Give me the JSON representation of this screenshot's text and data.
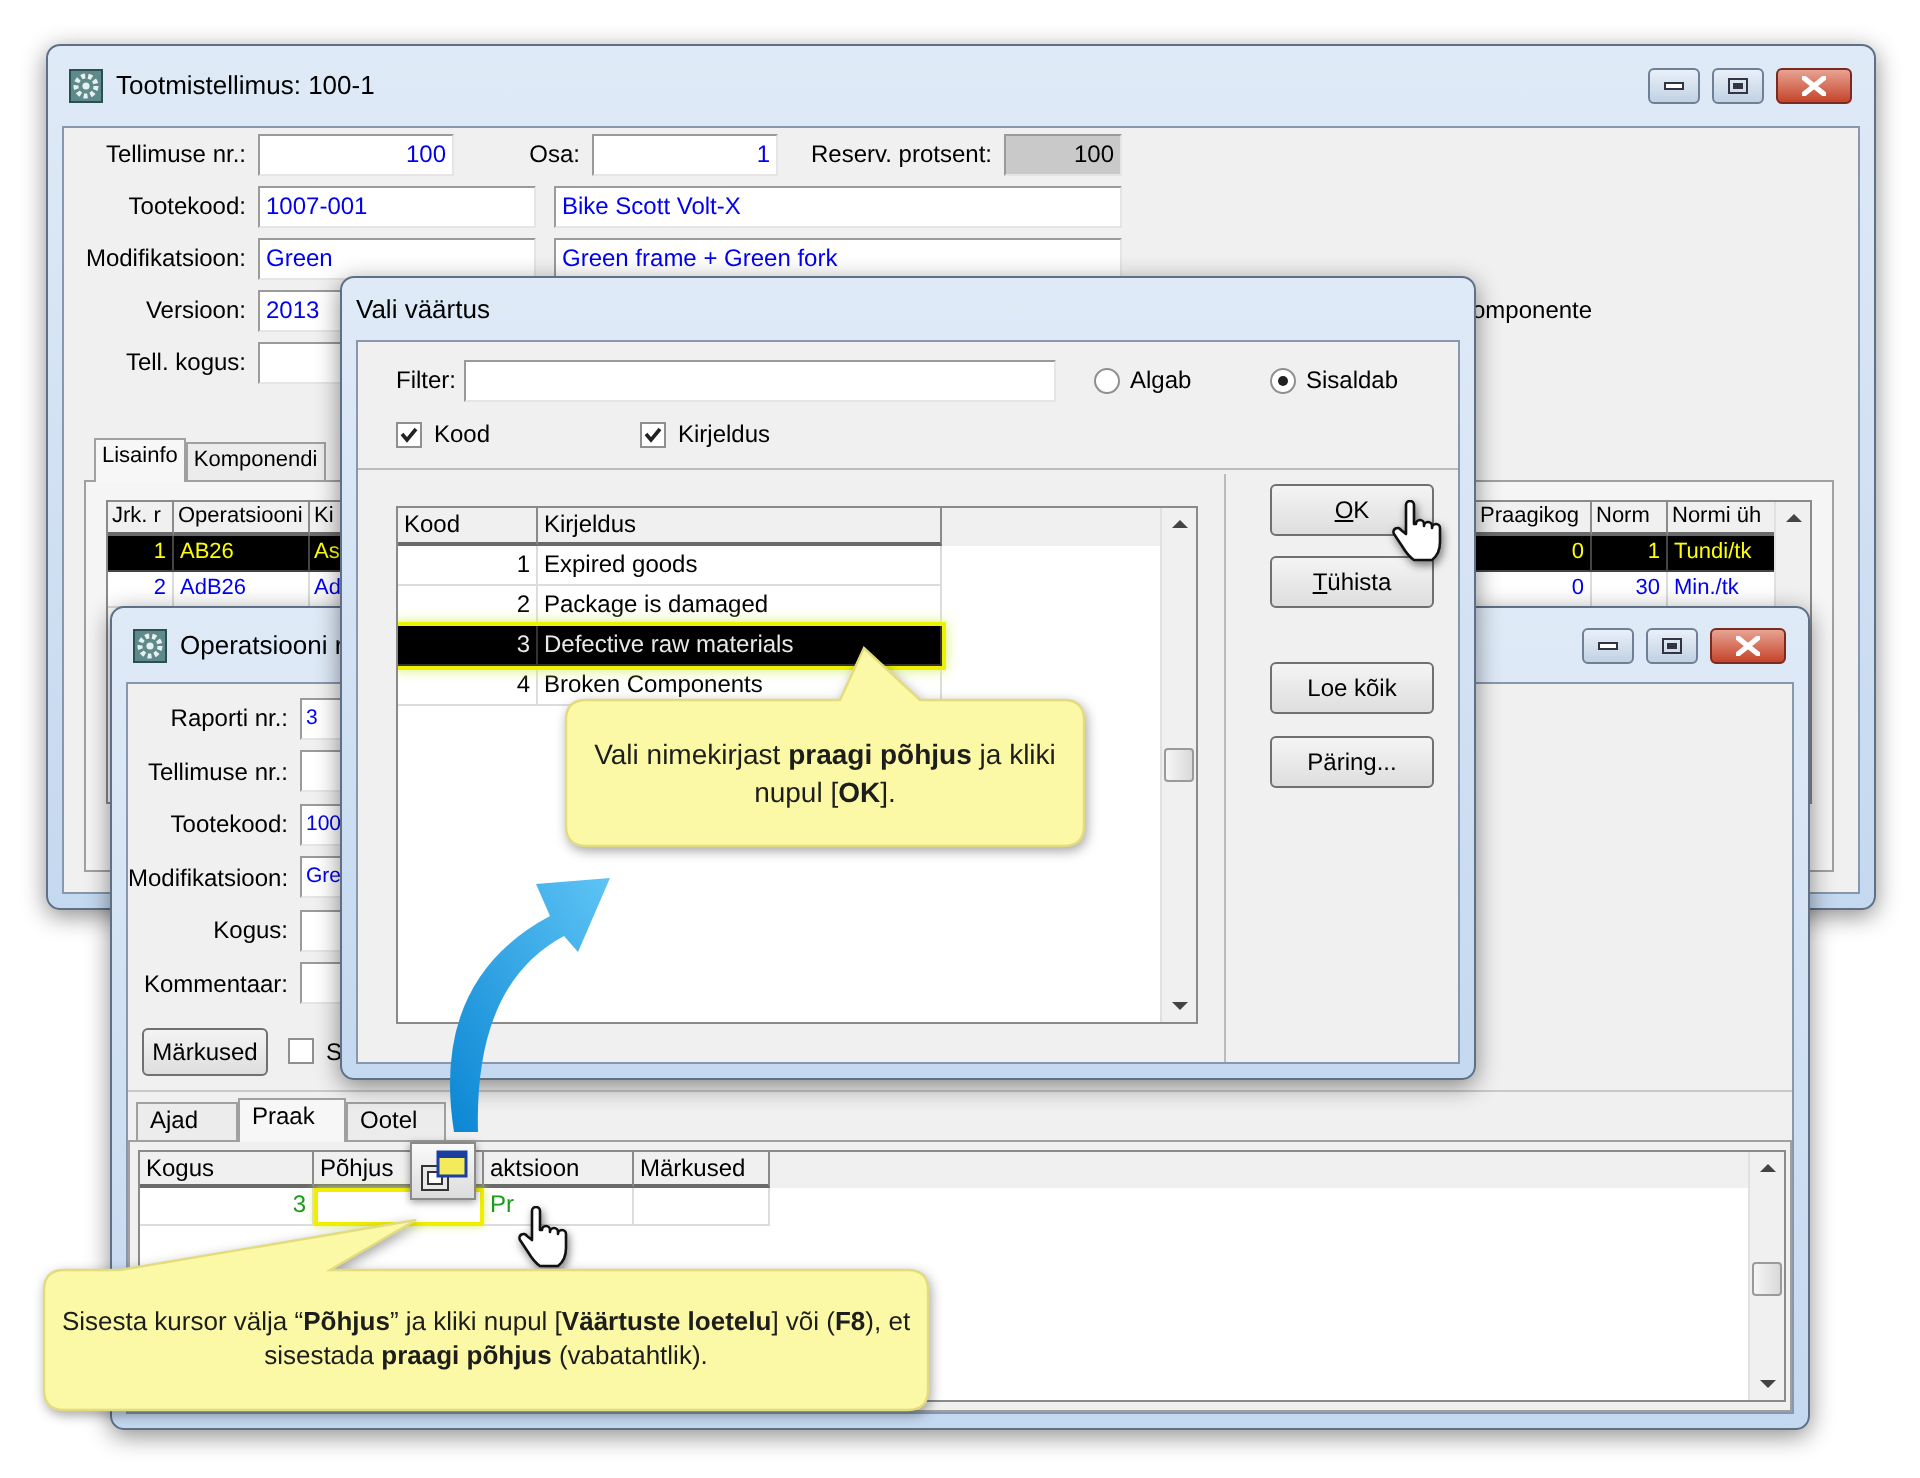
{
  "order_window": {
    "title": "Tootmistellimus: 100-1",
    "form_rows": [
      [
        {
          "kind": "label",
          "text": "Tellimuse nr.:"
        },
        {
          "kind": "input",
          "value": "100",
          "numeric": true,
          "disabled": false
        },
        {
          "kind": "label",
          "text": "Osa:"
        },
        {
          "kind": "input",
          "value": "1",
          "numeric": true,
          "disabled": false
        },
        {
          "kind": "label",
          "text": "Reserv. protsent:"
        },
        {
          "kind": "input",
          "value": "100",
          "numeric": true,
          "disabled": true
        }
      ],
      [
        {
          "kind": "label",
          "text": "Tootekood:"
        },
        {
          "kind": "input",
          "value": "1007-001",
          "numeric": false,
          "disabled": false
        },
        {
          "kind": "input",
          "value": "Bike Scott Volt-X",
          "numeric": false,
          "disabled": false
        }
      ],
      [
        {
          "kind": "label",
          "text": "Modifikatsioon:"
        },
        {
          "kind": "input",
          "value": "Green",
          "numeric": false,
          "disabled": false
        },
        {
          "kind": "input",
          "value": "Green frame + Green fork",
          "numeric": false,
          "disabled": false
        }
      ],
      [
        {
          "kind": "label",
          "text": "Versioon:"
        },
        {
          "kind": "input",
          "value": "2013",
          "numeric": false,
          "disabled": false
        },
        {
          "kind": "label",
          "text": "omponente"
        }
      ],
      [
        {
          "kind": "label",
          "text": "Tell. kogus:"
        },
        {
          "kind": "input",
          "disabled": false
        }
      ]
    ],
    "tabs": [
      {
        "label": "Lisainfo",
        "selected": true
      },
      {
        "label": "Komponendi",
        "selected": false
      }
    ],
    "grid": {
      "columns": [
        "Jrk. r",
        "Operatsiooni",
        "Ki",
        "Praagikog",
        "Norm",
        "Normi üh"
      ],
      "rows": [
        {
          "selected": true,
          "cells": [
            "1",
            "AB26",
            "As",
            "0",
            "1",
            "Tundi/tk"
          ]
        },
        {
          "selected": false,
          "cells": [
            "2",
            "AdB26",
            "Ad",
            "0",
            "30",
            "Min./tk"
          ]
        }
      ]
    }
  },
  "report_window": {
    "title": "Operatsiooni r",
    "form_rows": [
      [
        {
          "kind": "label",
          "text": "Raporti nr.:"
        },
        {
          "kind": "input",
          "value": "3",
          "numeric": false,
          "disabled": false
        }
      ],
      [
        {
          "kind": "label",
          "text": "Tellimuse nr.:"
        },
        {
          "kind": "input",
          "disabled": false
        }
      ],
      [
        {
          "kind": "label",
          "text": "Tootekood:"
        },
        {
          "kind": "input",
          "value": "100",
          "numeric": false,
          "disabled": false
        }
      ],
      [
        {
          "kind": "label",
          "text": "Modifikatsioon:"
        },
        {
          "kind": "input",
          "value": "Gre",
          "numeric": false,
          "disabled": false
        }
      ],
      [
        {
          "kind": "label",
          "text": "Kogus:"
        },
        {
          "kind": "input",
          "disabled": false
        }
      ],
      [
        {
          "kind": "label",
          "text": "Kommentaar:"
        },
        {
          "kind": "input",
          "disabled": false
        }
      ]
    ],
    "notes_button": "Märkused",
    "checkbox": {
      "label": "S",
      "checked": false
    },
    "tabs": [
      {
        "label": "Ajad",
        "selected": false
      },
      {
        "label": "Praak",
        "selected": true
      },
      {
        "label": "Ootel",
        "selected": false
      }
    ],
    "grid": {
      "columns": [
        "Kogus",
        "Põhjus",
        "aktsioon",
        "Märkused"
      ],
      "rows": [
        {
          "cells": [
            {
              "text": "3",
              "focused": false
            },
            {
              "focused": true
            },
            {
              "text": "Pr",
              "focused": false
            },
            {
              "focused": false
            }
          ]
        }
      ]
    }
  },
  "lookup_dialog": {
    "title": "Vali väärtus",
    "filter_label": "Filter:",
    "match_modes": [
      {
        "label": "Algab",
        "selected": false
      },
      {
        "label": "Sisaldab",
        "selected": true
      }
    ],
    "column_toggles": [
      {
        "label": "Kood",
        "checked": true
      },
      {
        "label": "Kirjeldus",
        "checked": true
      }
    ],
    "list": {
      "columns": [
        "Kood",
        "Kirjeldus"
      ],
      "rows": [
        {
          "code": "1",
          "description": "Expired goods",
          "selected": false
        },
        {
          "code": "2",
          "description": "Package is damaged",
          "selected": false
        },
        {
          "code": "3",
          "description": "Defective raw materials",
          "selected": true
        },
        {
          "code": "4",
          "description": "Broken Components",
          "selected": false
        }
      ]
    },
    "buttons": [
      {
        "label": "OK",
        "mnemonic": true
      },
      {
        "label": "Tühista",
        "mnemonic": true
      },
      {
        "label": "Loe kõik",
        "mnemonic": false
      },
      {
        "label": "Päring...",
        "mnemonic": false
      }
    ]
  },
  "callouts": [
    {
      "text": "Vali nimekirjast **praagi põhjus** ja kliki nupul [**OK**]."
    },
    {
      "text": "Sisesta kursor välja “**Põhjus**” ja kliki nupul [**Väärtuste loetelu**] või (**F8**), et sisestada **praagi põhjus** (vabatahtlik)."
    }
  ]
}
